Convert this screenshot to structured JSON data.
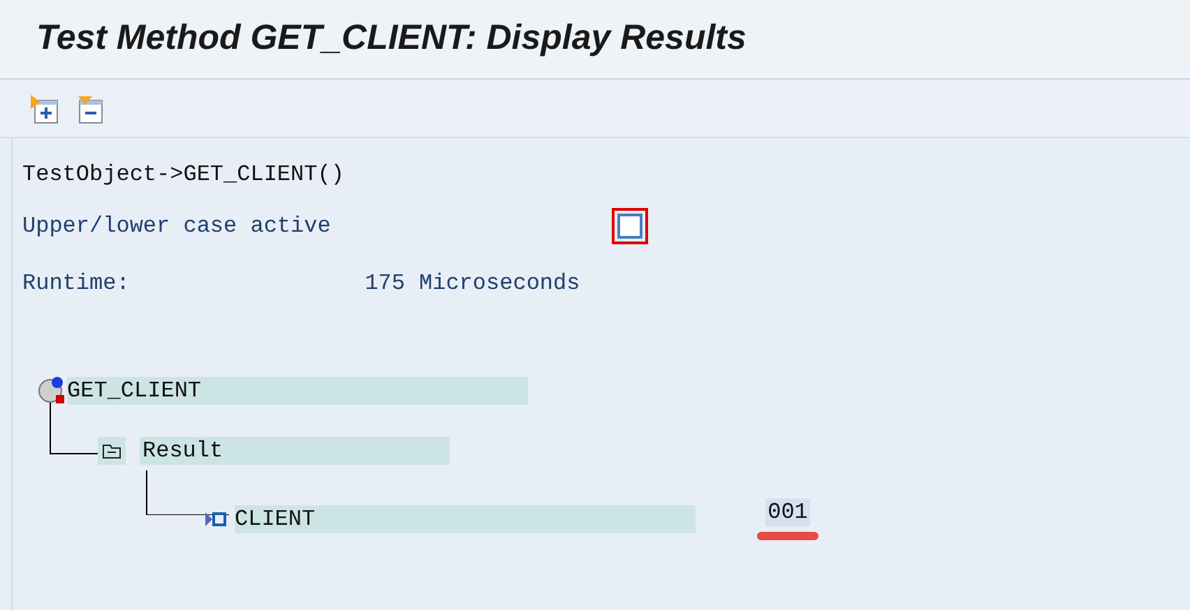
{
  "window": {
    "title": "Test Method GET_CLIENT: Display Results"
  },
  "header_line": "TestObject->GET_CLIENT()",
  "case_option": {
    "label": "Upper/lower case active",
    "checked": false
  },
  "runtime": {
    "label": "Runtime:",
    "value": "175",
    "unit": "Microseconds"
  },
  "tree": {
    "label": "GET_CLIENT",
    "children": [
      {
        "label": "Result",
        "children": [
          {
            "label": "CLIENT",
            "value": "001"
          }
        ]
      }
    ]
  }
}
